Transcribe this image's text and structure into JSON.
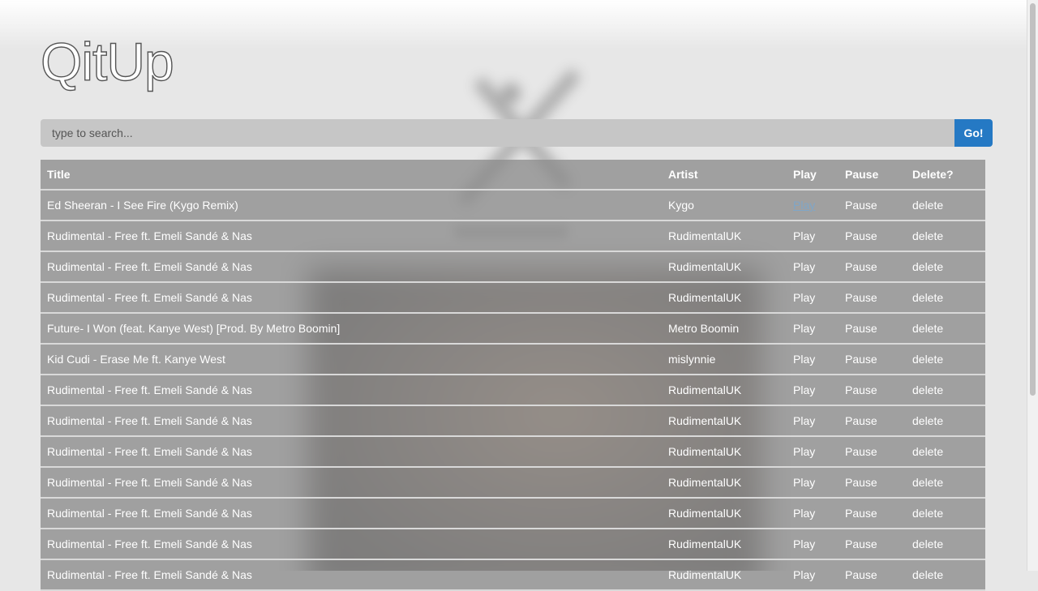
{
  "app": {
    "title": "QitUp"
  },
  "search": {
    "placeholder": "type to search...",
    "button_label": "Go!"
  },
  "table": {
    "headers": {
      "title": "Title",
      "artist": "Artist",
      "play": "Play",
      "pause": "Pause",
      "delete": "Delete?"
    },
    "rows": [
      {
        "title": "Ed Sheeran - I See Fire (Kygo Remix)",
        "artist": "Kygo",
        "play": "Play",
        "pause": "Pause",
        "delete": "delete"
      },
      {
        "title": "Rudimental - Free ft. Emeli Sandé & Nas",
        "artist": "RudimentalUK",
        "play": "Play",
        "pause": "Pause",
        "delete": "delete"
      },
      {
        "title": "Rudimental - Free ft. Emeli Sandé & Nas",
        "artist": "RudimentalUK",
        "play": "Play",
        "pause": "Pause",
        "delete": "delete"
      },
      {
        "title": "Rudimental - Free ft. Emeli Sandé & Nas",
        "artist": "RudimentalUK",
        "play": "Play",
        "pause": "Pause",
        "delete": "delete"
      },
      {
        "title": "Future- I Won (feat. Kanye West) [Prod. By Metro Boomin]",
        "artist": "Metro Boomin",
        "play": "Play",
        "pause": "Pause",
        "delete": "delete"
      },
      {
        "title": "Kid Cudi - Erase Me ft. Kanye West",
        "artist": "mislynnie",
        "play": "Play",
        "pause": "Pause",
        "delete": "delete"
      },
      {
        "title": "Rudimental - Free ft. Emeli Sandé & Nas",
        "artist": "RudimentalUK",
        "play": "Play",
        "pause": "Pause",
        "delete": "delete"
      },
      {
        "title": "Rudimental - Free ft. Emeli Sandé & Nas",
        "artist": "RudimentalUK",
        "play": "Play",
        "pause": "Pause",
        "delete": "delete"
      },
      {
        "title": "Rudimental - Free ft. Emeli Sandé & Nas",
        "artist": "RudimentalUK",
        "play": "Play",
        "pause": "Pause",
        "delete": "delete"
      },
      {
        "title": "Rudimental - Free ft. Emeli Sandé & Nas",
        "artist": "RudimentalUK",
        "play": "Play",
        "pause": "Pause",
        "delete": "delete"
      },
      {
        "title": "Rudimental - Free ft. Emeli Sandé & Nas",
        "artist": "RudimentalUK",
        "play": "Play",
        "pause": "Pause",
        "delete": "delete"
      },
      {
        "title": "Rudimental - Free ft. Emeli Sandé & Nas",
        "artist": "RudimentalUK",
        "play": "Play",
        "pause": "Pause",
        "delete": "delete"
      },
      {
        "title": "Rudimental - Free ft. Emeli Sandé & Nas",
        "artist": "RudimentalUK",
        "play": "Play",
        "pause": "Pause",
        "delete": "delete"
      }
    ]
  },
  "colors": {
    "accent": "#2579c4",
    "link": "#7fa6c8",
    "row_bg": "#8c8c8c"
  }
}
